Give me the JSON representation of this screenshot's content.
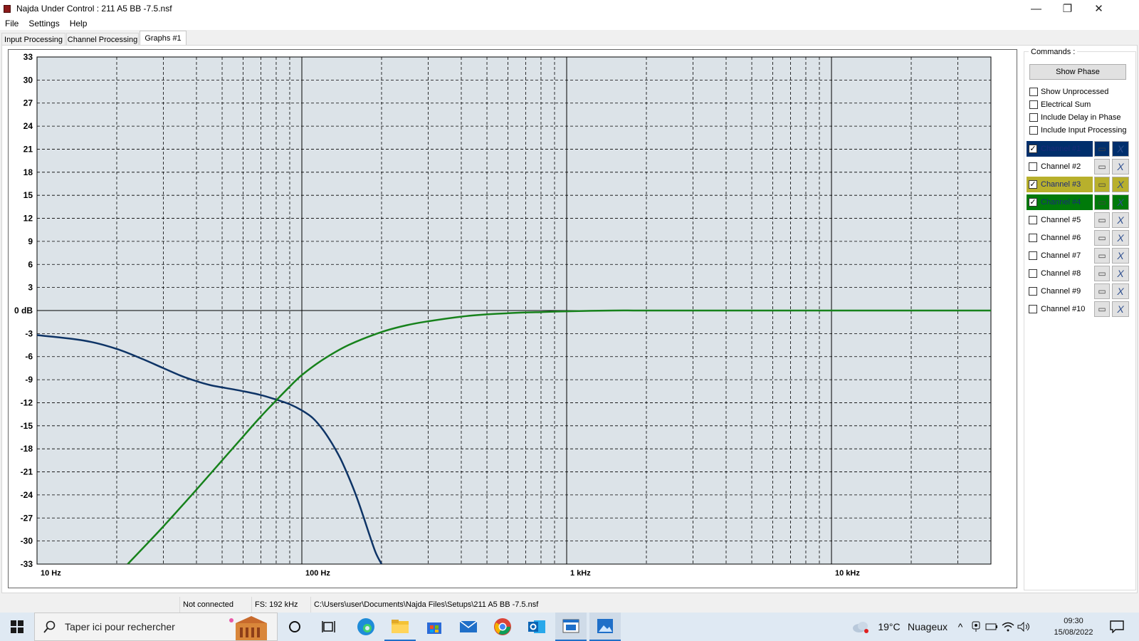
{
  "window": {
    "title": "Najda Under Control : 211 A5 BB -7.5.nsf",
    "controls": {
      "minimize": "—",
      "restore": "❐",
      "close": "✕"
    }
  },
  "menu": [
    "File",
    "Settings",
    "Help"
  ],
  "tabs": [
    {
      "label": "Input Processing",
      "active": false
    },
    {
      "label": "Channel Processing",
      "active": false
    },
    {
      "label": "Graphs #1",
      "active": true
    }
  ],
  "commands": {
    "label": "Commands :",
    "show_phase": "Show Phase",
    "options": [
      {
        "label": "Show Unprocessed",
        "checked": false
      },
      {
        "label": "Electrical Sum",
        "checked": false
      },
      {
        "label": "Include Delay in Phase",
        "checked": false
      },
      {
        "label": "Include Input Processing",
        "checked": false
      }
    ],
    "channels": [
      {
        "label": "Channel #1",
        "checked": true,
        "color": "#002f6c"
      },
      {
        "label": "Channel #2",
        "checked": false,
        "color": null
      },
      {
        "label": "Channel #3",
        "checked": true,
        "color": "#b8b02c"
      },
      {
        "label": "Channel #4",
        "checked": true,
        "color": "#007a0a"
      },
      {
        "label": "Channel #5",
        "checked": false,
        "color": null
      },
      {
        "label": "Channel #6",
        "checked": false,
        "color": null
      },
      {
        "label": "Channel #7",
        "checked": false,
        "color": null
      },
      {
        "label": "Channel #8",
        "checked": false,
        "color": null
      },
      {
        "label": "Channel #9",
        "checked": false,
        "color": null
      },
      {
        "label": "Channel #10",
        "checked": false,
        "color": null
      }
    ]
  },
  "status": {
    "connection": "Not connected",
    "sample_rate": "FS: 192 kHz",
    "file_path": "C:\\Users\\user\\Documents\\Najda Files\\Setups\\211 A5 BB -7.5.nsf"
  },
  "taskbar": {
    "search_placeholder": "Taper ici pour rechercher",
    "weather_temp": "19°C",
    "weather_desc": "Nuageux",
    "time": "09:30",
    "date": "15/08/2022"
  },
  "chart_data": {
    "type": "line",
    "x_scale": "log",
    "xlim": [
      10,
      40000
    ],
    "ylim": [
      -33,
      33
    ],
    "x_tick_labels": [
      {
        "value": 10,
        "label": "10 Hz"
      },
      {
        "value": 100,
        "label": "100 Hz"
      },
      {
        "value": 1000,
        "label": "1 kHz"
      },
      {
        "value": 10000,
        "label": "10 kHz"
      }
    ],
    "y_ticks": [
      33,
      30,
      27,
      24,
      21,
      18,
      15,
      12,
      9,
      6,
      3,
      0,
      -3,
      -6,
      -9,
      -12,
      -15,
      -18,
      -21,
      -24,
      -27,
      -30,
      -33
    ],
    "y_zero_label": "0 dB",
    "grid": true,
    "series": [
      {
        "name": "Channel #1",
        "color": "#0e3466",
        "x": [
          10,
          15,
          20,
          25,
          30,
          35,
          40,
          45,
          50,
          60,
          70,
          80,
          90,
          100,
          110,
          120,
          130,
          140,
          150,
          160,
          170,
          180,
          190,
          200
        ],
        "y": [
          -3.2,
          -3.9,
          -5.0,
          -6.3,
          -7.5,
          -8.5,
          -9.2,
          -9.7,
          -10.0,
          -10.5,
          -11.0,
          -11.6,
          -12.2,
          -13.0,
          -14.0,
          -15.5,
          -17.3,
          -19.3,
          -21.6,
          -24.0,
          -26.6,
          -29.2,
          -31.5,
          -33.0
        ]
      },
      {
        "name": "Channel #4",
        "color": "#17821c",
        "x": [
          22,
          30,
          40,
          50,
          60,
          70,
          80,
          90,
          100,
          120,
          150,
          200,
          250,
          300,
          400,
          500,
          600,
          700,
          800,
          1000,
          1500,
          2000,
          5000,
          10000,
          40000
        ],
        "y": [
          -33.0,
          -28.1,
          -23.3,
          -19.5,
          -16.4,
          -13.8,
          -11.7,
          -9.9,
          -8.4,
          -6.4,
          -4.5,
          -2.8,
          -1.9,
          -1.4,
          -0.8,
          -0.5,
          -0.35,
          -0.25,
          -0.2,
          -0.1,
          0.0,
          0.0,
          0.0,
          0.0,
          0.0
        ]
      }
    ]
  }
}
